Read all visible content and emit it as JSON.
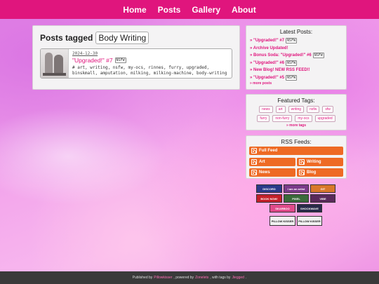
{
  "nav": {
    "home": "Home",
    "posts": "Posts",
    "gallery": "Gallery",
    "about": "About"
  },
  "main": {
    "heading_prefix": "Posts tagged",
    "tag": "Body Writing",
    "post": {
      "date": "2024-12-30",
      "title": "\"Upgraded!\" #7",
      "badge": "NSFW",
      "tags": "# art, writing, nsfw, my-ocs, rinnes, furry, upgraded, binskmall, amputation, milking, milking-machine, body-writing"
    }
  },
  "latest": {
    "title": "Latest Posts:",
    "items": [
      {
        "label": "» \"Upgraded!\" #7",
        "badge": "NSFW"
      },
      {
        "label": "» Archive Updated!",
        "badge": ""
      },
      {
        "label": "» Bonus Soda: \"Upgraded!\" #6",
        "badge": "NSFW"
      },
      {
        "label": "» \"Upgraded!\" #6",
        "badge": "NSFW"
      },
      {
        "label": "» New Blog! NEW RSS FEED!!",
        "badge": ""
      },
      {
        "label": "» \"Upgraded!\" #5",
        "badge": "NSFW"
      }
    ],
    "more": "» more posts"
  },
  "featured": {
    "title": "Featured Tags:",
    "tags": [
      "news",
      "art",
      "writing",
      "nsfw",
      "sfw",
      "furry",
      "non-furry",
      "my-ocs",
      "upgraded"
    ],
    "more": "» more tags"
  },
  "rss": {
    "title": "RSS Feeds:",
    "full": "Full Feed",
    "art": "Art",
    "writing": "Writing",
    "news": "News",
    "blog": "Blog"
  },
  "badges": {
    "b1": "DISCORD",
    "b2": "I am an artist",
    "b3": "GIT",
    "b4": "BOOK NOW!",
    "b5": "PIXEL",
    "b6": "VIBE",
    "b7": "SKARBOO",
    "b8": "SHOCKWAVE",
    "b9": "PILLOW KISSER",
    "b10": "PILLOW KISSER"
  },
  "footer": {
    "pre": "Published by",
    "site_gen": "Pillowkisser",
    "mid": ", powered by",
    "engine": "Zonelets",
    "mid2": ", with tags by",
    "tagger": "Jiegged",
    "end": "."
  },
  "colors": {
    "accent": "#e0157d",
    "rss": "#ee6a24",
    "footer_bg": "#3a3a3a"
  }
}
